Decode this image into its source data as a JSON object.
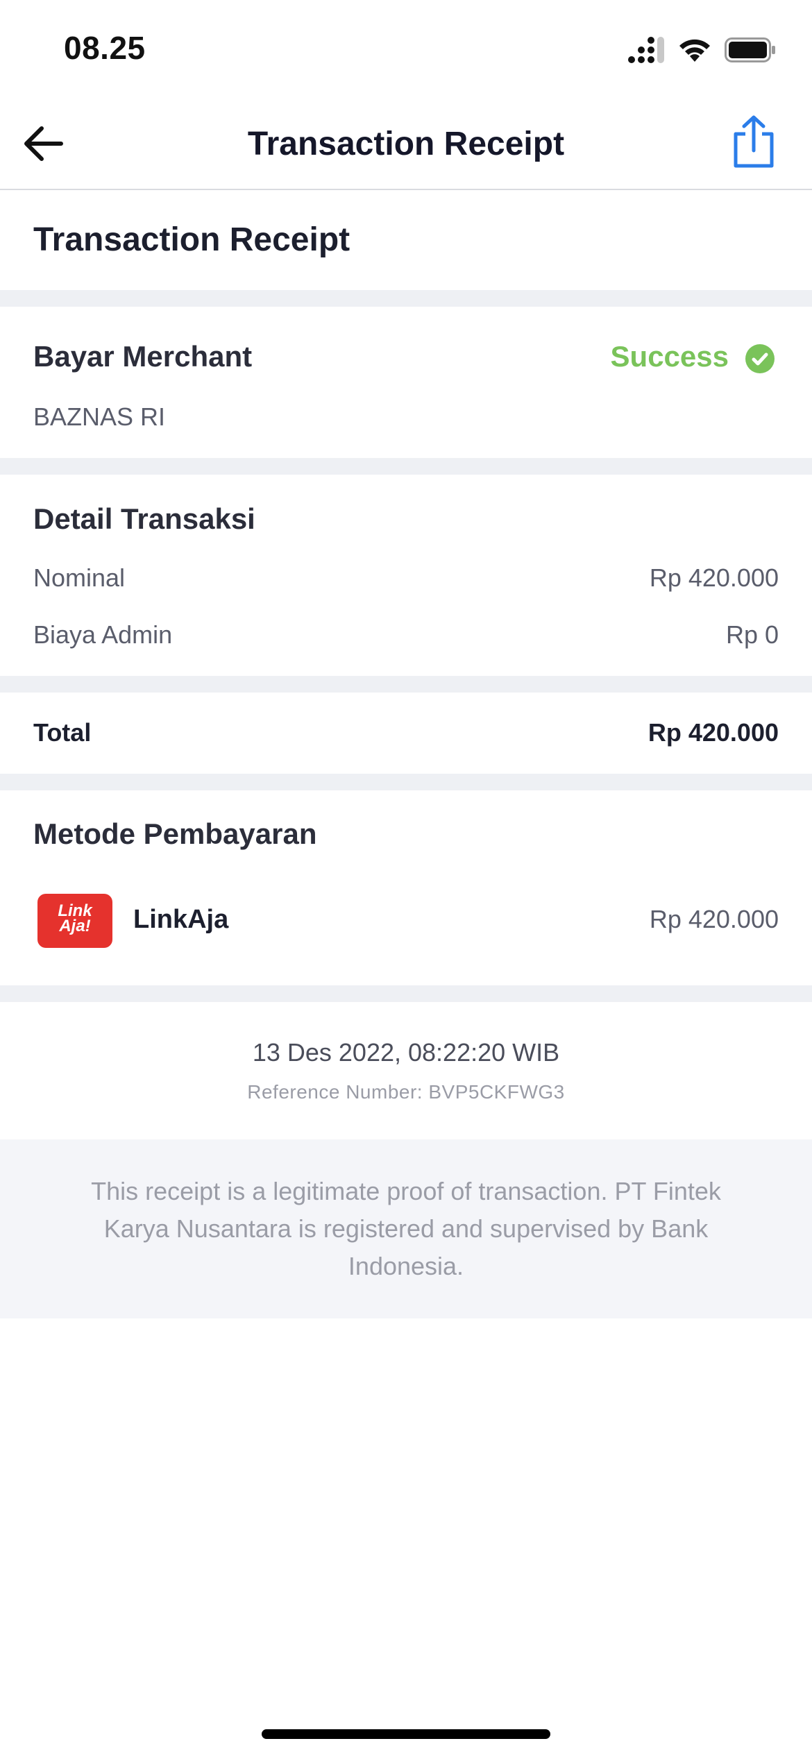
{
  "status_bar": {
    "time": "08.25"
  },
  "nav": {
    "title": "Transaction Receipt"
  },
  "receipt": {
    "heading": "Transaction Receipt"
  },
  "merchant": {
    "type": "Bayar Merchant",
    "status": "Success",
    "name": "BAZNAS RI",
    "status_color": "#7ac35a"
  },
  "detail": {
    "heading": "Detail Transaksi",
    "rows": [
      {
        "label": "Nominal",
        "value": "Rp 420.000"
      },
      {
        "label": "Biaya Admin",
        "value": "Rp 0"
      }
    ]
  },
  "total": {
    "label": "Total",
    "value": "Rp 420.000"
  },
  "payment": {
    "heading": "Metode Pembayaran",
    "method": "LinkAja",
    "amount": "Rp 420.000",
    "logo_text": [
      "Link",
      "Aja!"
    ],
    "logo_color": "#e5322d"
  },
  "meta": {
    "datetime": "13 Des 2022, 08:22:20 WIB",
    "reference": "Reference Number: BVP5CKFWG3"
  },
  "footer": {
    "disclaimer": "This receipt is a legitimate proof of transaction. PT Fintek Karya Nusantara is registered and supervised by Bank Indonesia."
  },
  "colors": {
    "accent": "#2b7de9",
    "separator": "#eef0f4"
  }
}
